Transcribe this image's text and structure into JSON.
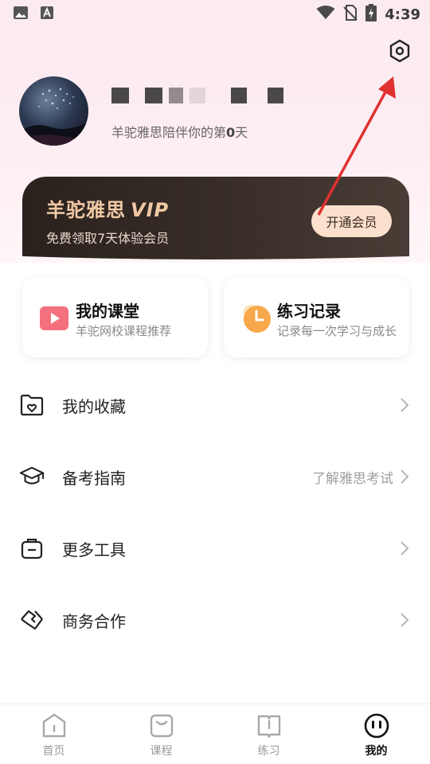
{
  "status_bar": {
    "time": "4:39",
    "left_icons": [
      "image-icon",
      "text-a-icon"
    ],
    "right_icons": [
      "wifi-icon",
      "no-sim-icon",
      "battery-charging-icon"
    ]
  },
  "profile": {
    "tagline_prefix": "羊驼雅思陪伴你的第",
    "tagline_days": "0",
    "tagline_suffix": "天"
  },
  "vip": {
    "title": "羊驼雅思",
    "title_badge": "VIP",
    "subtitle": "免费领取7天体验会员",
    "button": "开通会员"
  },
  "cards": [
    {
      "title": "我的课堂",
      "subtitle": "羊驼网校课程推荐",
      "icon": "play-icon"
    },
    {
      "title": "练习记录",
      "subtitle": "记录每一次学习与成长",
      "icon": "clock-icon"
    }
  ],
  "menu": [
    {
      "label": "我的收藏",
      "icon": "folder-heart-icon",
      "hint": ""
    },
    {
      "label": "备考指南",
      "icon": "graduation-cap-icon",
      "hint": "了解雅思考试"
    },
    {
      "label": "更多工具",
      "icon": "toolbox-icon",
      "hint": ""
    },
    {
      "label": "商务合作",
      "icon": "handshake-icon",
      "hint": ""
    }
  ],
  "tabs": [
    {
      "label": "首页",
      "icon": "home-icon",
      "active": false
    },
    {
      "label": "课程",
      "icon": "course-icon",
      "active": false
    },
    {
      "label": "练习",
      "icon": "practice-icon",
      "active": false
    },
    {
      "label": "我的",
      "icon": "me-icon",
      "active": true
    }
  ],
  "colors": {
    "vip_gold": "#f1c9a5",
    "vip_button_bg": "#fbe1cd",
    "card_play": "#f4707e",
    "card_clock": "#f7a84a",
    "annotation_arrow": "#e03131"
  }
}
